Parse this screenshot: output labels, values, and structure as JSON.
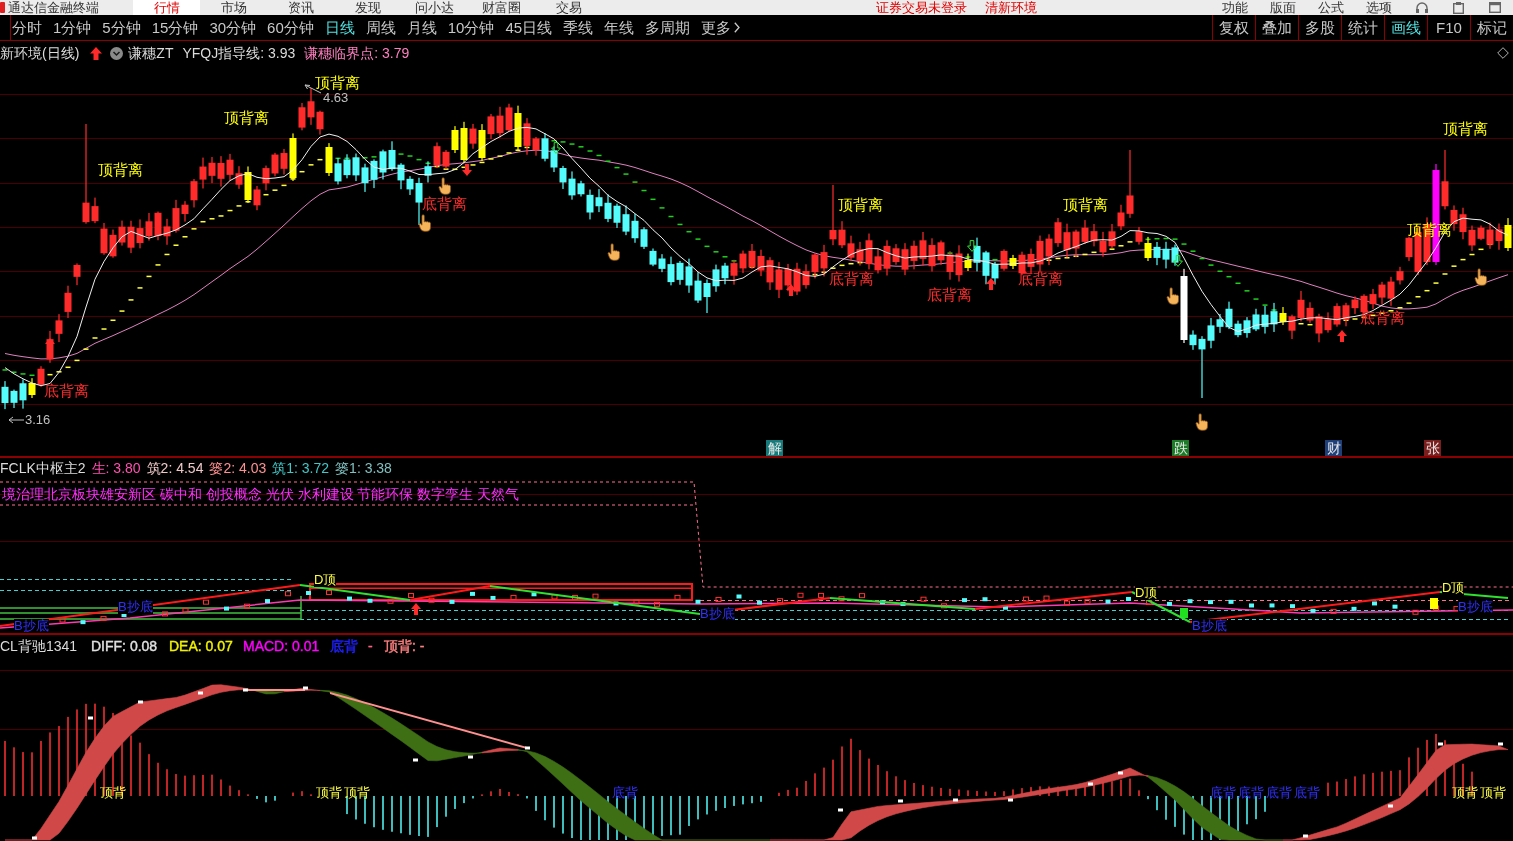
{
  "menu_bar": {
    "app_title": "通达信金融终端",
    "items": [
      {
        "label": "行情",
        "selected": true
      },
      {
        "label": "市场",
        "selected": false
      },
      {
        "label": "资讯",
        "selected": false
      },
      {
        "label": "发现",
        "selected": false
      },
      {
        "label": "问小达",
        "selected": false
      },
      {
        "label": "财富圈",
        "selected": false
      },
      {
        "label": "交易",
        "selected": false
      }
    ],
    "login_notice": "证券交易未登录",
    "environment": "清新环境",
    "right_items": [
      "功能",
      "版面",
      "公式",
      "选项"
    ]
  },
  "period_bar": {
    "periods": [
      {
        "label": "分时",
        "selected": false
      },
      {
        "label": "1分钟",
        "selected": false
      },
      {
        "label": "5分钟",
        "selected": false
      },
      {
        "label": "15分钟",
        "selected": false
      },
      {
        "label": "30分钟",
        "selected": false
      },
      {
        "label": "60分钟",
        "selected": false
      },
      {
        "label": "日线",
        "selected": true
      },
      {
        "label": "周线",
        "selected": false
      },
      {
        "label": "月线",
        "selected": false
      },
      {
        "label": "10分钟",
        "selected": false
      },
      {
        "label": "45日线",
        "selected": false
      },
      {
        "label": "季线",
        "selected": false
      },
      {
        "label": "年线",
        "selected": false
      },
      {
        "label": "多周期",
        "selected": false
      }
    ],
    "more": "更多",
    "tools": [
      {
        "label": "复权",
        "selected": false
      },
      {
        "label": "叠加",
        "selected": false
      },
      {
        "label": "多股",
        "selected": false
      },
      {
        "label": "统计",
        "selected": false
      },
      {
        "label": "画线",
        "selected": true
      },
      {
        "label": "F10",
        "selected": false
      },
      {
        "label": "标记",
        "selected": false
      }
    ]
  },
  "price_pane": {
    "title": "新环境(日线)",
    "indicator": "谦穗ZT",
    "readouts": [
      {
        "text": "YFQJ指导线: 3.93",
        "color": "#dcdcdc"
      },
      {
        "text": "谦穗临界点: 3.79",
        "color": "#ff80c0"
      }
    ],
    "high_label": "4.63",
    "low_label": "3.16",
    "signals": [
      {
        "text": "底背离",
        "kind": "bottom"
      },
      {
        "text": "顶背离",
        "kind": "top"
      },
      {
        "text": "顶背离",
        "kind": "top"
      },
      {
        "text": "顶背离",
        "kind": "top"
      },
      {
        "text": "底背离",
        "kind": "bottom"
      },
      {
        "text": "底背离",
        "kind": "bottom"
      },
      {
        "text": "顶背离",
        "kind": "top"
      },
      {
        "text": "底背离",
        "kind": "bottom"
      },
      {
        "text": "底背离",
        "kind": "bottom"
      },
      {
        "text": "顶背离",
        "kind": "top"
      },
      {
        "text": "底背离",
        "kind": "bottom"
      },
      {
        "text": "顶背离",
        "kind": "top"
      },
      {
        "text": "顶背离",
        "kind": "top"
      }
    ],
    "event_tags": [
      {
        "text": "解",
        "color": "#167a7a"
      },
      {
        "text": "跌",
        "color": "#1d7a28"
      },
      {
        "text": "财",
        "color": "#1e3f78"
      },
      {
        "text": "张",
        "color": "#7a1e1e"
      }
    ]
  },
  "pivot_pane": {
    "title": "FCLK中枢主2",
    "readouts": [
      {
        "text": "生: 3.80",
        "color": "#ff50b0"
      },
      {
        "text": "筑2: 4.54",
        "color": "#f0c8c8"
      },
      {
        "text": "篓2: 4.03",
        "color": "#ff9090"
      },
      {
        "text": "筑1: 3.72",
        "color": "#40c8c8"
      },
      {
        "text": "篓1: 3.38",
        "color": "#80c0c0"
      }
    ],
    "sector_tags": "境治理北京板块雄安新区 碳中和 创投概念 光伏 水利建设 节能环保 数字孪生 天然气",
    "markers": [
      {
        "text": "B抄底",
        "kind": "bottom"
      },
      {
        "text": "B抄底",
        "kind": "bottom"
      },
      {
        "text": "D顶",
        "kind": "top"
      },
      {
        "text": "B抄底",
        "kind": "bottom"
      },
      {
        "text": "D顶",
        "kind": "top"
      },
      {
        "text": "B抄底",
        "kind": "bottom"
      },
      {
        "text": "D顶",
        "kind": "top"
      },
      {
        "text": "B抄底",
        "kind": "bottom"
      }
    ]
  },
  "macd_pane": {
    "title": "CL背驰1341",
    "readouts": [
      {
        "text": "DIFF: 0.08",
        "color": "#e0e0e0"
      },
      {
        "text": "DEA: 0.07",
        "color": "#f0f000"
      },
      {
        "text": "MACD: 0.01",
        "color": "#ff00ff"
      },
      {
        "text": "底背",
        "color": "#2020ff"
      },
      {
        "text": "-",
        "color": "#ff6080"
      },
      {
        "text": "顶背: -",
        "color": "#ff8080"
      }
    ],
    "markers": [
      {
        "text": "顶背",
        "kind": "top"
      },
      {
        "text": "顶背",
        "kind": "top"
      },
      {
        "text": "顶背",
        "kind": "top"
      },
      {
        "text": "底背",
        "kind": "bottom"
      },
      {
        "text": "底背",
        "kind": "bottom"
      },
      {
        "text": "底背",
        "kind": "bottom"
      },
      {
        "text": "底背",
        "kind": "bottom"
      },
      {
        "text": "底背",
        "kind": "bottom"
      },
      {
        "text": "顶背",
        "kind": "top"
      },
      {
        "text": "顶背",
        "kind": "top"
      }
    ]
  }
}
